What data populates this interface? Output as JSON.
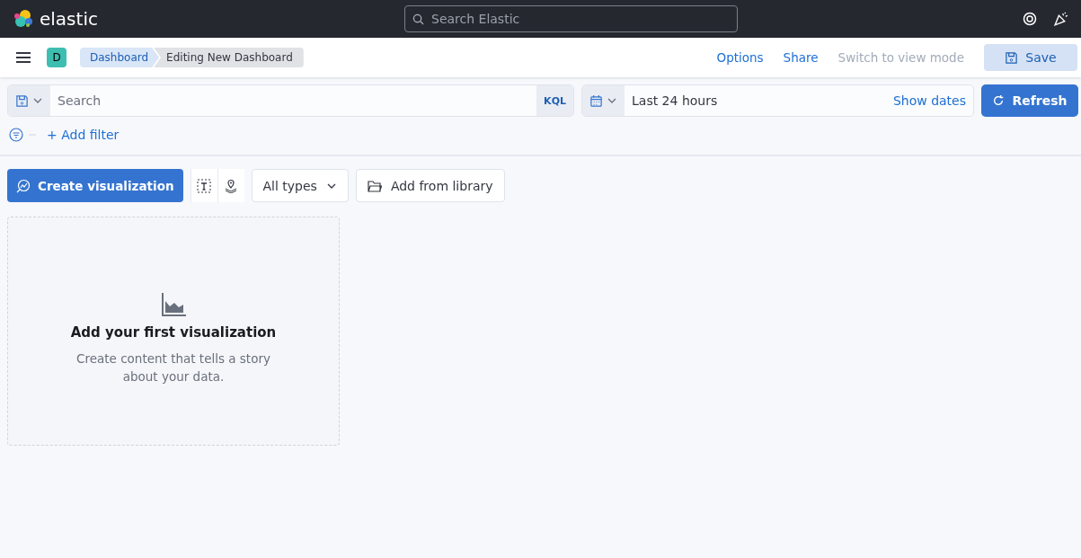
{
  "header": {
    "brand": "elastic",
    "search": {
      "placeholder": "Search Elastic"
    }
  },
  "nav": {
    "avatar": "D",
    "breadcrumbs": [
      {
        "label": "Dashboard",
        "selected": false
      },
      {
        "label": "Editing New Dashboard",
        "selected": true
      }
    ],
    "actions": [
      {
        "label": "Options",
        "disabled": false
      },
      {
        "label": "Share",
        "disabled": false
      },
      {
        "label": "Switch to view mode",
        "disabled": true
      }
    ],
    "save": "Save"
  },
  "query": {
    "search": {
      "placeholder": "Search"
    },
    "language": "KQL",
    "time": "Last 24 hours",
    "show_dates": "Show dates",
    "refresh": "Refresh",
    "add_filter": "+ Add filter"
  },
  "toolbar": {
    "create": "Create visualization",
    "types": "All types",
    "library": "Add from library"
  },
  "empty_panel": {
    "title": "Add your first visualization",
    "description": "Create content that tells a story about your data."
  }
}
